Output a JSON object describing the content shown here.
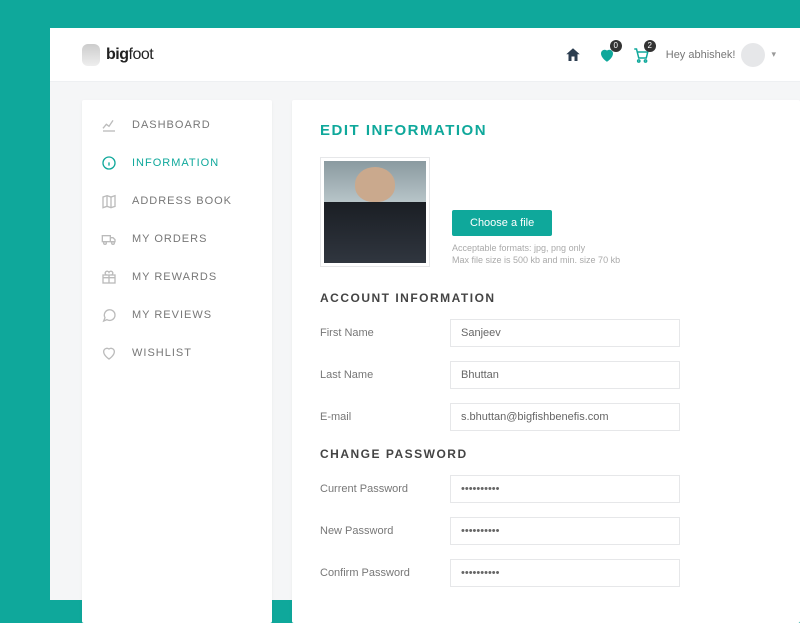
{
  "header": {
    "logo_big": "big",
    "logo_foot": "foot",
    "wishlist_count": "0",
    "cart_count": "2",
    "greeting": "Hey abhishek!"
  },
  "sidebar": {
    "items": [
      {
        "label": "DASHBOARD"
      },
      {
        "label": "INFORMATION"
      },
      {
        "label": "ADDRESS BOOK"
      },
      {
        "label": "MY ORDERS"
      },
      {
        "label": "MY REWARDS"
      },
      {
        "label": "MY REVIEWS"
      },
      {
        "label": "WISHLIST"
      }
    ]
  },
  "main": {
    "page_title": "EDIT INFORMATION",
    "choose_file": "Choose a file",
    "hint_line1": "Acceptable formats: jpg, png only",
    "hint_line2": "Max file size is 500 kb and min. size 70 kb",
    "account_section": "ACCOUNT INFORMATION",
    "first_name_label": "First Name",
    "first_name_value": "Sanjeev",
    "last_name_label": "Last Name",
    "last_name_value": "Bhuttan",
    "email_label": "E-mail",
    "email_value": "s.bhuttan@bigfishbenefis.com",
    "password_section": "CHANGE PASSWORD",
    "current_pw_label": "Current Password",
    "current_pw_value": "••••••••••",
    "new_pw_label": "New Password",
    "new_pw_value": "••••••••••",
    "confirm_pw_label": "Confirm Password",
    "confirm_pw_value": "••••••••••"
  }
}
